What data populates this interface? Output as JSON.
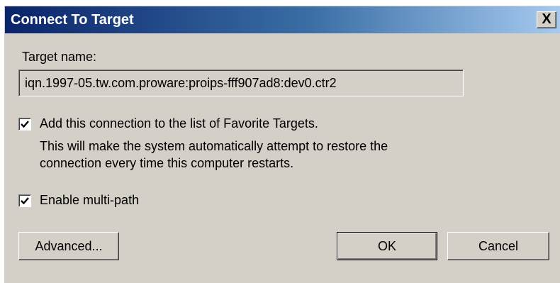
{
  "window": {
    "title": "Connect To Target",
    "close_label": "X"
  },
  "target": {
    "label": "Target name:",
    "value": "iqn.1997-05.tw.com.proware:proips-fff907ad8:dev0.ctr2"
  },
  "favorites": {
    "checked": true,
    "label": "Add this connection to the list of Favorite Targets.",
    "description_line1": "This will make the system automatically attempt to restore the",
    "description_line2": "connection every time this computer restarts."
  },
  "multipath": {
    "checked": true,
    "label": "Enable multi-path"
  },
  "buttons": {
    "advanced": "Advanced...",
    "ok": "OK",
    "cancel": "Cancel"
  }
}
